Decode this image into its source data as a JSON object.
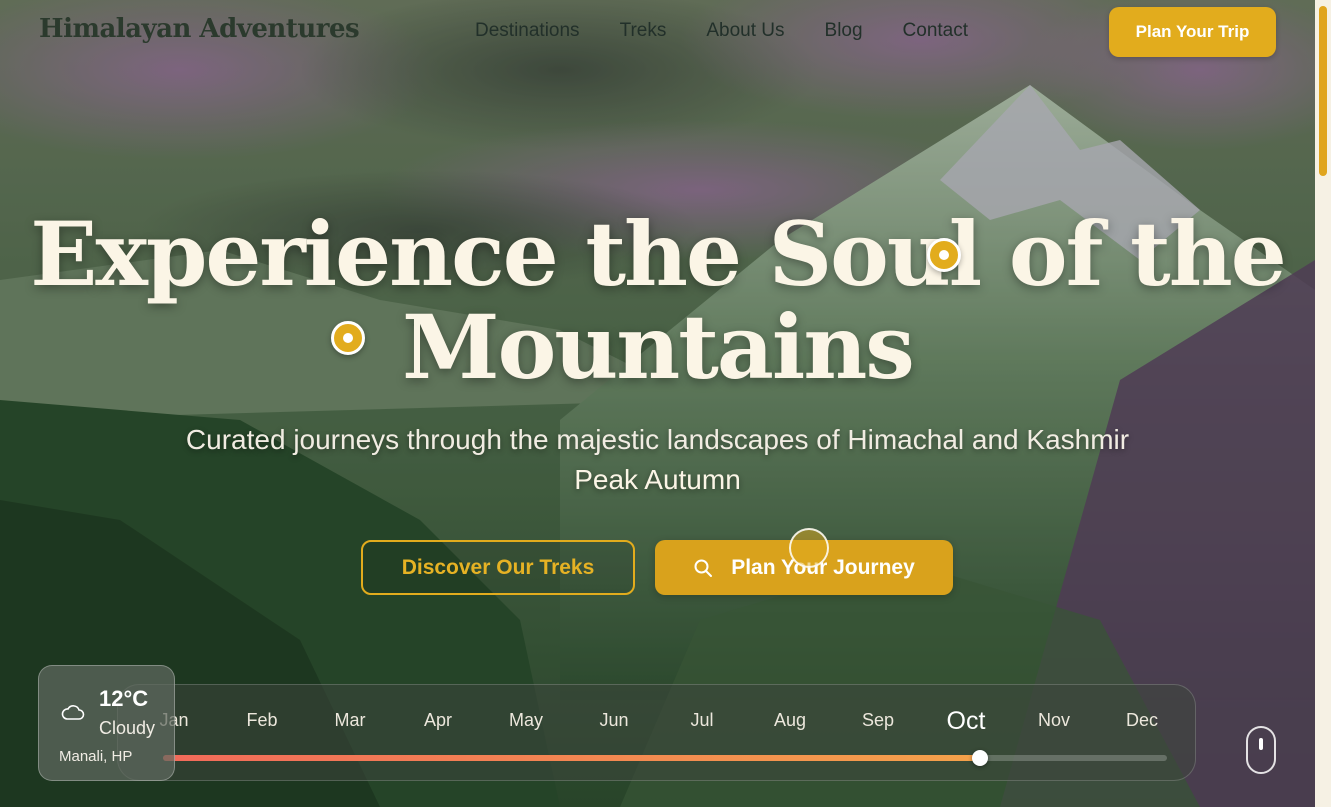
{
  "brand": {
    "logo": "Himalayan Adventures"
  },
  "nav": {
    "links": [
      "Destinations",
      "Treks",
      "About Us",
      "Blog",
      "Contact"
    ],
    "cta": "Plan Your Trip"
  },
  "hero": {
    "title_line1": "Experience the Soul of the",
    "title_line2": "Mountains",
    "subtitle": "Curated journeys through the majestic landscapes of Himachal and Kashmir",
    "season": "Peak Autumn",
    "buttons": {
      "discover": "Discover Our Treks",
      "plan": "Plan Your Journey"
    }
  },
  "timeline": {
    "months": [
      "Jan",
      "Feb",
      "Mar",
      "Apr",
      "May",
      "Jun",
      "Jul",
      "Aug",
      "Sep",
      "Oct",
      "Nov",
      "Dec"
    ],
    "active_month": "Oct",
    "progress_percent": 82
  },
  "weather": {
    "temp": "12°C",
    "condition": "Cloudy",
    "location": "Manali, HP",
    "icon": "cloud-icon"
  },
  "colors": {
    "accent": "#e2ac1d",
    "title": "#fbf5e6",
    "progress_start": "#f26a5a",
    "progress_end": "#f4a24a"
  }
}
